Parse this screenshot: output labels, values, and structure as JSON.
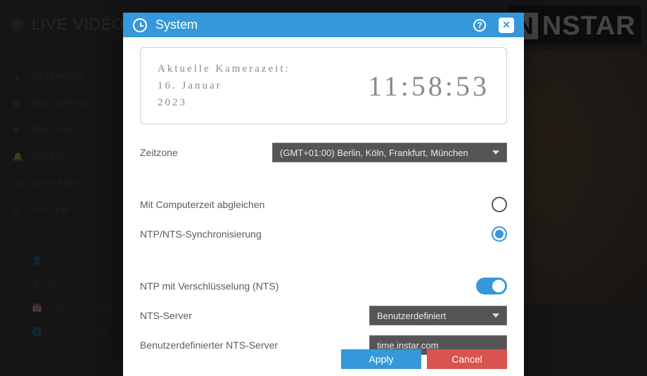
{
  "brand": "NSTAR",
  "bg_title": "LIVE VIDEO",
  "sidebar": {
    "items": [
      {
        "label": "NETZWERK"
      },
      {
        "label": "MULTIMEDIA"
      },
      {
        "label": "FEATURES"
      },
      {
        "label": "ALARM"
      },
      {
        "label": "AUFGABEN"
      },
      {
        "label": "SYSTEM"
      }
    ],
    "sub": [
      {
        "label": "Übersicht"
      },
      {
        "label": "Benutzer"
      },
      {
        "label": "WebUI"
      },
      {
        "label": "Datum & Uhrzeit"
      },
      {
        "label": "Sprachauswahl"
      }
    ]
  },
  "modal": {
    "title": "System",
    "time_panel": {
      "heading": "Aktuelle Kamerazeit:",
      "date_line1": "16. Januar",
      "date_line2": "2023",
      "clock": "11:58:53"
    },
    "rows": {
      "timezone_label": "Zeitzone",
      "timezone_value": "(GMT+01:00) Berlin, Köln, Frankfurt, München",
      "sync_pc_label": "Mit Computerzeit abgleichen",
      "ntp_sync_label": "NTP/NTS-Synchronisierung",
      "nts_encrypt_label": "NTP mit Verschlüsselung (NTS)",
      "nts_server_label": "NTS-Server",
      "nts_server_value": "Benutzerdefiniert",
      "custom_nts_label": "Benutzerdefinierter NTS-Server",
      "custom_nts_value": "time.instar.com"
    },
    "buttons": {
      "apply": "Apply",
      "cancel": "Cancel"
    }
  }
}
